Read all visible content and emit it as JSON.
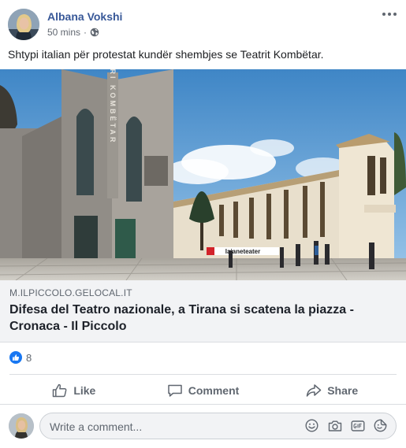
{
  "post": {
    "author": "Albana Vokshi",
    "timestamp": "50 mins",
    "separator": "·",
    "privacy_icon": "globe-icon",
    "more_icon": "more-options-icon",
    "text": "Shtypi italian për protestat kundër shembjes se Teatrit Kombëtar."
  },
  "link_preview": {
    "image_text": {
      "facade_sign": "TEATRI KOMBËTAR",
      "banner_sign": "lajaneteater"
    },
    "domain": "M.ILPICCOLO.GELOCAL.IT",
    "title": "Difesa del Teatro nazionale, a Tirana si scatena la piazza - Cronaca - Il Piccolo"
  },
  "reactions": {
    "icon": "like-reaction-icon",
    "count": "8"
  },
  "actions": {
    "like_label": "Like",
    "comment_label": "Comment",
    "share_label": "Share"
  },
  "composer": {
    "placeholder": "Write a comment...",
    "icons": [
      "emoji-icon",
      "camera-icon",
      "gif-icon",
      "sticker-icon"
    ]
  },
  "colors": {
    "author_link": "#385898",
    "like_blue": "#1877f2",
    "muted_text": "#606770",
    "link_box_bg": "#f2f3f5"
  }
}
